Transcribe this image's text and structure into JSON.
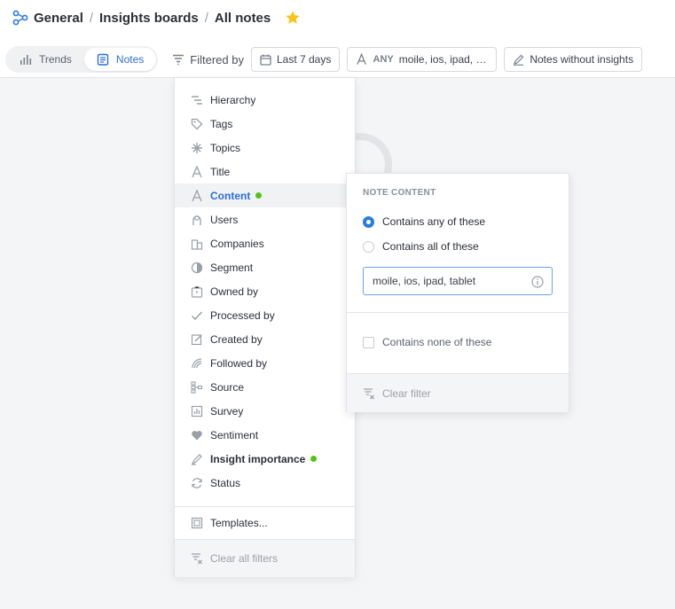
{
  "breadcrumb": [
    "General",
    "Insights boards",
    "All notes"
  ],
  "view_tabs": [
    {
      "label": "Trends",
      "icon": "bar-chart-icon",
      "active": false
    },
    {
      "label": "Notes",
      "icon": "notes-icon",
      "active": true
    }
  ],
  "filtered_by_label": "Filtered by",
  "chips": {
    "date": "Last 7 days",
    "content_any": "ANY",
    "content_terms": "moile, ios, ipad, ta...",
    "without_insights": "Notes without insights"
  },
  "filter_menu": {
    "items": [
      {
        "label": "Hierarchy",
        "icon": "hierarchy-icon"
      },
      {
        "label": "Tags",
        "icon": "tag-icon"
      },
      {
        "label": "Topics",
        "icon": "topics-icon"
      },
      {
        "label": "Title",
        "icon": "title-icon"
      },
      {
        "label": "Content",
        "icon": "content-icon",
        "active": true,
        "has_filter": true
      },
      {
        "label": "Users",
        "icon": "user-icon"
      },
      {
        "label": "Companies",
        "icon": "company-icon"
      },
      {
        "label": "Segment",
        "icon": "segment-icon"
      },
      {
        "label": "Owned by",
        "icon": "owner-icon"
      },
      {
        "label": "Processed by",
        "icon": "check-icon"
      },
      {
        "label": "Created by",
        "icon": "edit-icon"
      },
      {
        "label": "Followed by",
        "icon": "follow-icon"
      },
      {
        "label": "Source",
        "icon": "source-icon"
      },
      {
        "label": "Survey",
        "icon": "survey-icon"
      },
      {
        "label": "Sentiment",
        "icon": "heart-icon"
      },
      {
        "label": "Insight importance",
        "icon": "importance-icon",
        "bold": true,
        "has_filter": true
      },
      {
        "label": "Status",
        "icon": "status-icon"
      }
    ],
    "templates_label": "Templates...",
    "clear_all_label": "Clear all filters"
  },
  "content_panel": {
    "heading": "NOTE CONTENT",
    "options": [
      {
        "label": "Contains any of these",
        "selected": true
      },
      {
        "label": "Contains all of these",
        "selected": false
      }
    ],
    "input_value": "moile, ios, ipad, tablet",
    "none_label": "Contains none of these",
    "clear_label": "Clear filter"
  },
  "colors": {
    "accent": "#2b6fd6",
    "radio": "#2b7be0",
    "indicator": "#52c41a",
    "star": "#f5c518"
  }
}
